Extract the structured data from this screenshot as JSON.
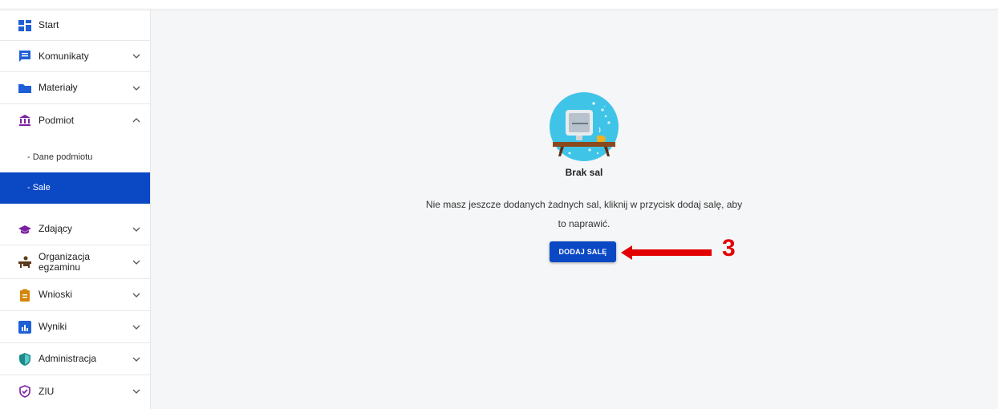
{
  "sidebar": {
    "items": [
      {
        "label": "Start",
        "icon": "dashboard-icon"
      },
      {
        "label": "Komunikaty",
        "icon": "message-icon"
      },
      {
        "label": "Materiały",
        "icon": "folder-icon"
      },
      {
        "label": "Podmiot",
        "icon": "institution-icon"
      },
      {
        "label": "Zdający",
        "icon": "graduation-cap-icon"
      },
      {
        "label": "Organizacja\negzaminu",
        "icon": "desk-icon"
      },
      {
        "label": "Wnioski",
        "icon": "clipboard-icon"
      },
      {
        "label": "Wyniki",
        "icon": "bar-chart-icon"
      },
      {
        "label": "Administracja",
        "icon": "shield-icon"
      },
      {
        "label": "ZIU",
        "icon": "badge-check-icon"
      }
    ],
    "subitems": [
      {
        "label": "- Dane podmiotu"
      },
      {
        "label": "- Sale",
        "active": true
      }
    ]
  },
  "empty_state": {
    "title": "Brak sal",
    "description": "Nie masz jeszcze dodanych żadnych sal, kliknij w przycisk dodaj salę, aby to naprawić.",
    "button_label": "DODAJ SALĘ",
    "illustration_icon": "computer-desk-icon"
  },
  "annotation": {
    "marker": "3",
    "color": "#e30000"
  },
  "colors": {
    "primary": "#0b48c4",
    "background": "#f5f6f7"
  }
}
